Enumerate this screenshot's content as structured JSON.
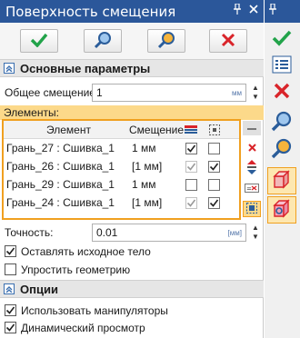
{
  "window": {
    "title": "Поверхность смещения",
    "pin_icon": "pin-icon",
    "close_icon": "close-icon"
  },
  "actions": [
    {
      "name": "ok",
      "icon": "check-icon"
    },
    {
      "name": "preview",
      "icon": "magnifier-icon"
    },
    {
      "name": "preview-alt",
      "icon": "magnifier-orange-icon"
    },
    {
      "name": "cancel",
      "icon": "cross-icon"
    }
  ],
  "main_params": {
    "header": "Основные параметры",
    "offset_label": "Общее смещение:",
    "offset_value": "1",
    "offset_unit": "мм"
  },
  "elements": {
    "label": "Элементы:",
    "col_element": "Элемент",
    "col_offset": "Смещение",
    "rows": [
      {
        "element": "Грань_27 : Сшивка_1",
        "offset": "1 мм",
        "c1": true,
        "c1_disabled": false,
        "c2": false
      },
      {
        "element": "Грань_26 : Сшивка_1",
        "offset": "[1 мм]",
        "c1": true,
        "c1_disabled": true,
        "c2": true
      },
      {
        "element": "Грань_29 : Сшивка_1",
        "offset": "1 мм",
        "c1": false,
        "c1_disabled": false,
        "c2": false
      },
      {
        "element": "Грань_24 : Сшивка_1",
        "offset": "[1 мм]",
        "c1": true,
        "c1_disabled": true,
        "c2": true
      }
    ]
  },
  "precision": {
    "label": "Точность:",
    "value": "0.01",
    "unit": "[мм]"
  },
  "options_checks": {
    "keep_source": {
      "label": "Оставлять исходное тело",
      "checked": true
    },
    "simplify": {
      "label": "Упростить геометрию",
      "checked": false
    }
  },
  "options": {
    "header": "Опции",
    "use_manipulators": {
      "label": "Использовать манипуляторы",
      "checked": true
    },
    "dynamic_preview": {
      "label": "Динамический просмотр",
      "checked": true
    }
  },
  "right_toolbar": [
    "check-icon",
    "list-icon",
    "cross-icon",
    "magnifier-icon",
    "magnifier-orange-icon",
    "cube-red-icon",
    "cube-pink-icon"
  ],
  "colors": {
    "title_bg": "#2b579a",
    "accent": "#f0a020",
    "highlight_bg": "#fcd98a",
    "ok_green": "#22a34a",
    "cancel_red": "#d9242a"
  }
}
